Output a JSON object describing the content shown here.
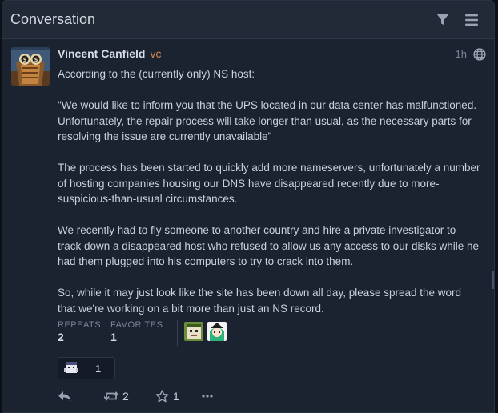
{
  "panel": {
    "title": "Conversation",
    "filter_icon": "filter-icon",
    "menu_icon": "menu-icon"
  },
  "post": {
    "author_name": "Vincent Canfield",
    "author_handle": "vc",
    "timeago": "1h",
    "visibility_icon": "globe-icon",
    "paragraphs": [
      "According to the (currently only) NS host:",
      "\"We would like to inform you that the UPS located in our data center has malfunctioned. Unfortunately, the repair process will take longer than usual, as the necessary parts for resolving the issue are currently unavailable\"",
      "The process has been started to quickly add more nameservers, unfortunately a number of hosting companies housing our DNS have disappeared recently due to more-suspicious-than-usual circumstances.",
      "We recently had to fly someone to another country and hire a private investigator to track down a disappeared host who refused to allow us any access to our disks while he had them plugged into his computers to try to crack into them.",
      "So, while it may just look like the site has been down all day, please spread the word that we're working on a bit more than just an NS record."
    ],
    "stats": {
      "repeats_label": "REPEATS",
      "repeats_count": "2",
      "favorites_label": "FAVORITES",
      "favorites_count": "1"
    },
    "reaction": {
      "emoji_icon": "custom-emoji-icon",
      "count": "1"
    },
    "actions": {
      "reply_icon": "reply-icon",
      "repeat_icon": "retweet-icon",
      "repeat_count": "2",
      "favorite_icon": "star-icon",
      "favorite_count": "1",
      "more_icon": "ellipsis-icon"
    }
  },
  "colors": {
    "panel_bg": "#1b2230",
    "header_bg": "#222a37",
    "handle": "#d0884e",
    "muted": "#7c8595"
  }
}
